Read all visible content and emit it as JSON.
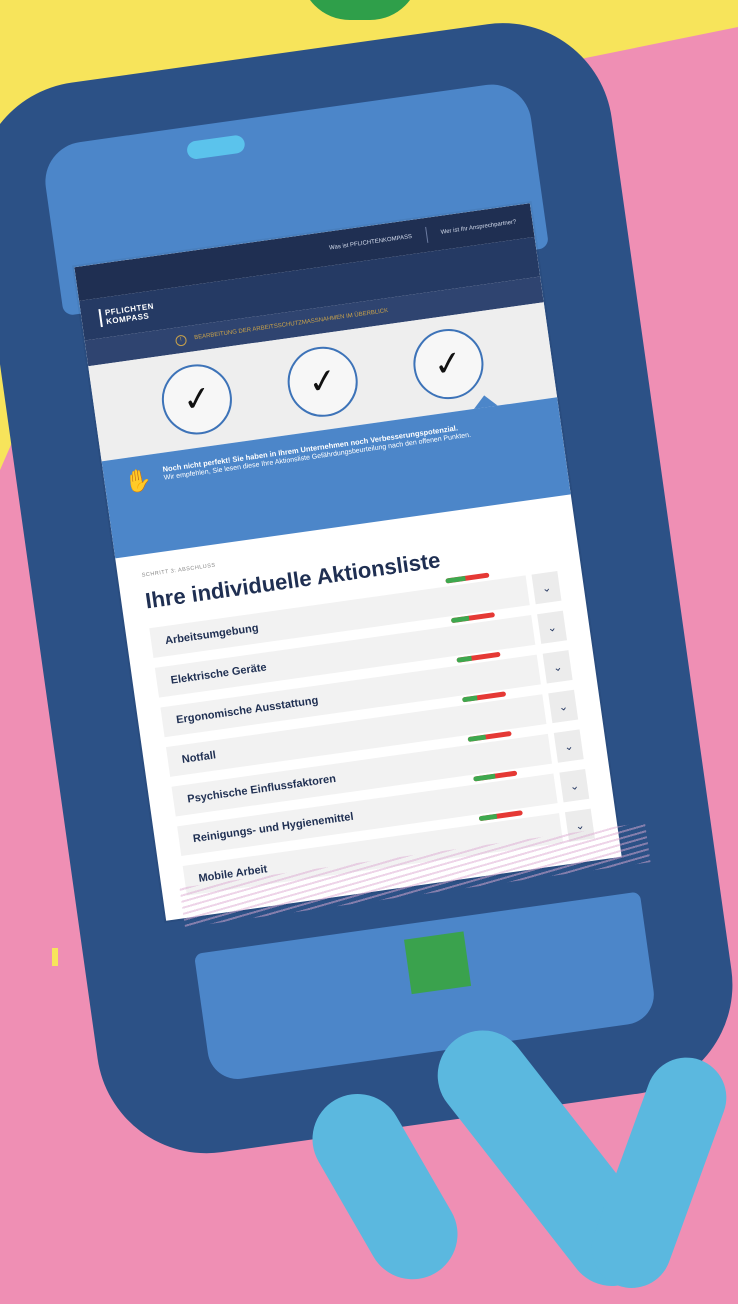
{
  "topbar": {
    "link1": "Was ist PFLICHTENKOMPASS",
    "link2": "Wer ist Ihr Ansprechpartner?"
  },
  "logo": {
    "line1": "PFLICHTEN",
    "line2": "KOMPASS"
  },
  "info": {
    "icon": "info-icon",
    "text": "BEARBEITUNG DER ARBEITSSCHUTZMASSNAHMEN IM ÜBERBLICK"
  },
  "steps": [
    {
      "label": "✓"
    },
    {
      "label": "✓"
    },
    {
      "label": "✓"
    }
  ],
  "notice": {
    "icon": "hand-icon",
    "title": "Noch nicht perfekt! Sie haben in Ihrem Unternehmen noch Verbesserungspotenzial.",
    "body": "Wir empfehlen, Sie lesen diese Ihre Aktionsliste Gefährdungsbeurteilung nach den offenen Punkten."
  },
  "main": {
    "progress_label": "SCHRITT 3: ABSCHLUSS",
    "title": "Ihre individuelle Aktionsliste",
    "items": [
      {
        "title": "Arbeitsumgebung",
        "progress": 0.45
      },
      {
        "title": "Elektrische Geräte",
        "progress": 0.4
      },
      {
        "title": "Ergonomische Ausstattung",
        "progress": 0.35
      },
      {
        "title": "Notfall",
        "progress": 0.35
      },
      {
        "title": "Psychische Einflussfaktoren",
        "progress": 0.4
      },
      {
        "title": "Reinigungs- und Hygienemittel",
        "progress": 0.5
      },
      {
        "title": "Mobile Arbeit",
        "progress": 0.4
      }
    ]
  },
  "colors": {
    "background": "#ef8fb4",
    "phone": "#2c5186",
    "accent": "#4c86c9",
    "navy": "#1f2f52",
    "bar_good": "#3ea84e",
    "bar_bad": "#e53935"
  }
}
